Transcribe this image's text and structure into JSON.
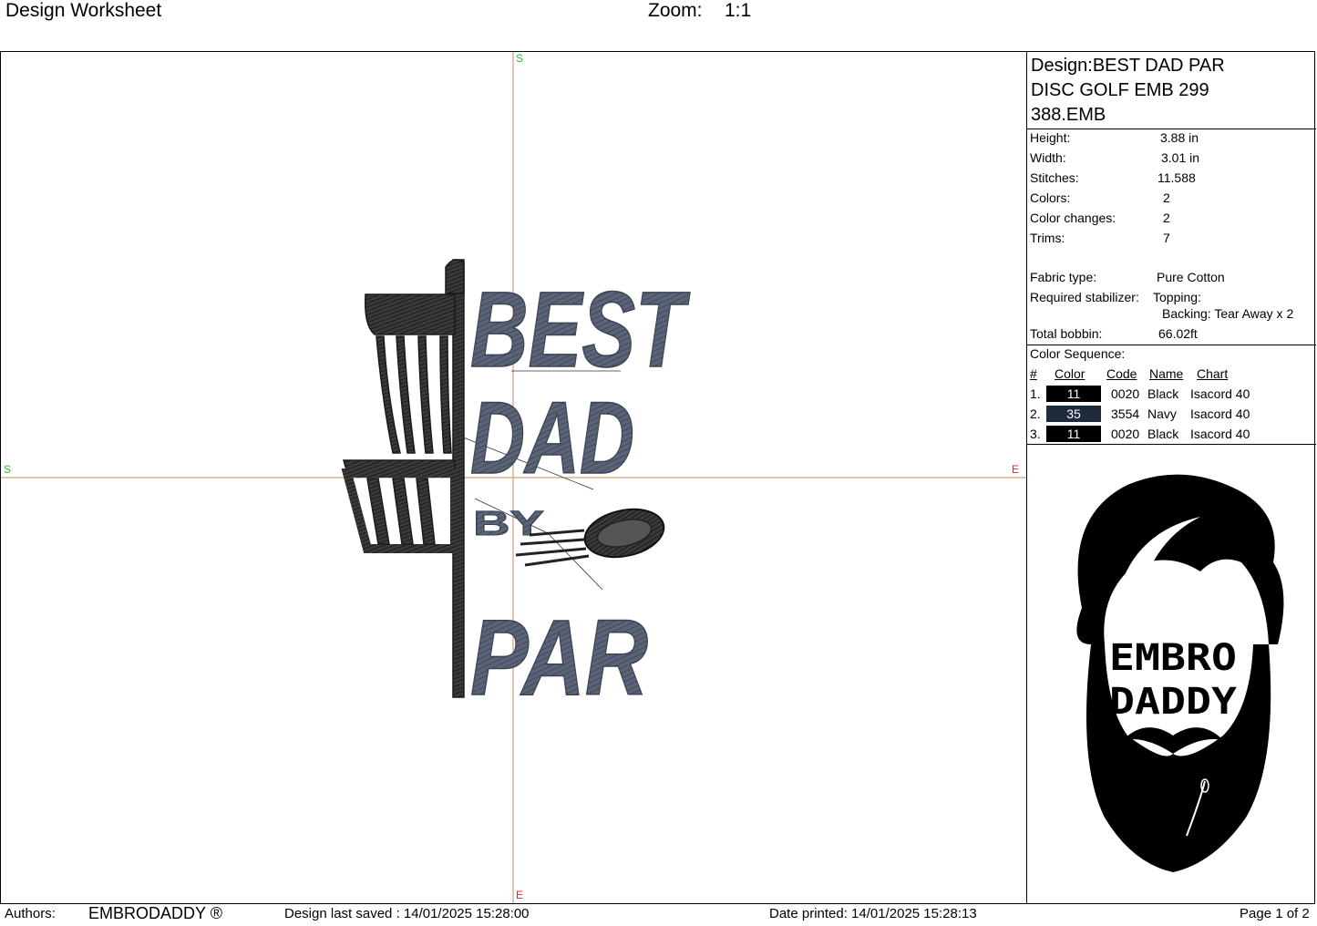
{
  "header": {
    "title": "Design Worksheet",
    "zoom_label": "Zoom:",
    "zoom_value": "1:1"
  },
  "canvas": {
    "markers": {
      "top": "S",
      "left": "S",
      "right": "E",
      "bottom": "E"
    },
    "design_text": {
      "line1": "BEST",
      "line2": "DAD",
      "line3": "BY",
      "line4": "PAR"
    },
    "colors": {
      "black_thread": "#2b2b2b",
      "navy_thread": "#4d5566",
      "crosshair": "#c98a5a"
    }
  },
  "panel": {
    "design_title": [
      "Design:BEST DAD PAR",
      "DISC GOLF EMB 299",
      "388.EMB"
    ],
    "stats": [
      {
        "label": "Height:",
        "value": "3.88 in"
      },
      {
        "label": "Width:",
        "value": "3.01 in"
      },
      {
        "label": "Stitches:",
        "value": "11.588"
      },
      {
        "label": "Colors:",
        "value": "2"
      },
      {
        "label": "Color changes:",
        "value": "2"
      },
      {
        "label": "Trims:",
        "value": "7"
      }
    ],
    "fabric_label": "Fabric type:",
    "fabric_value": "Pure Cotton",
    "stabilizer_label": "Required stabilizer:",
    "topping": "Topping:",
    "backing": "Backing: Tear Away x 2",
    "bobbin_label": "Total bobbin:",
    "bobbin_value": "66.02ft",
    "color_sequence_label": "Color Sequence:",
    "cs_headers": {
      "num": "#",
      "color": "Color",
      "code": "Code",
      "name": "Name",
      "chart": "Chart"
    },
    "color_rows": [
      {
        "num": "1.",
        "swatch": "11",
        "swatch_color": "#000000",
        "code": "0020",
        "name": "Black",
        "chart": "Isacord 40"
      },
      {
        "num": "2.",
        "swatch": "35",
        "swatch_color": "#1f2a3d",
        "code": "3554",
        "name": "Navy",
        "chart": "Isacord 40"
      },
      {
        "num": "3.",
        "swatch": "11",
        "swatch_color": "#000000",
        "code": "0020",
        "name": "Black",
        "chart": "Isacord 40"
      }
    ],
    "logo_text": {
      "line1": "EMBRO",
      "line2": "DADDY"
    }
  },
  "footer": {
    "authors_label": "Authors:",
    "authors_value": "EMBRODADDY ®",
    "saved": "Design last saved : 14/01/2025 15:28:00",
    "printed": "Date printed: 14/01/2025 15:28:13",
    "page": "Page 1 of 2"
  }
}
